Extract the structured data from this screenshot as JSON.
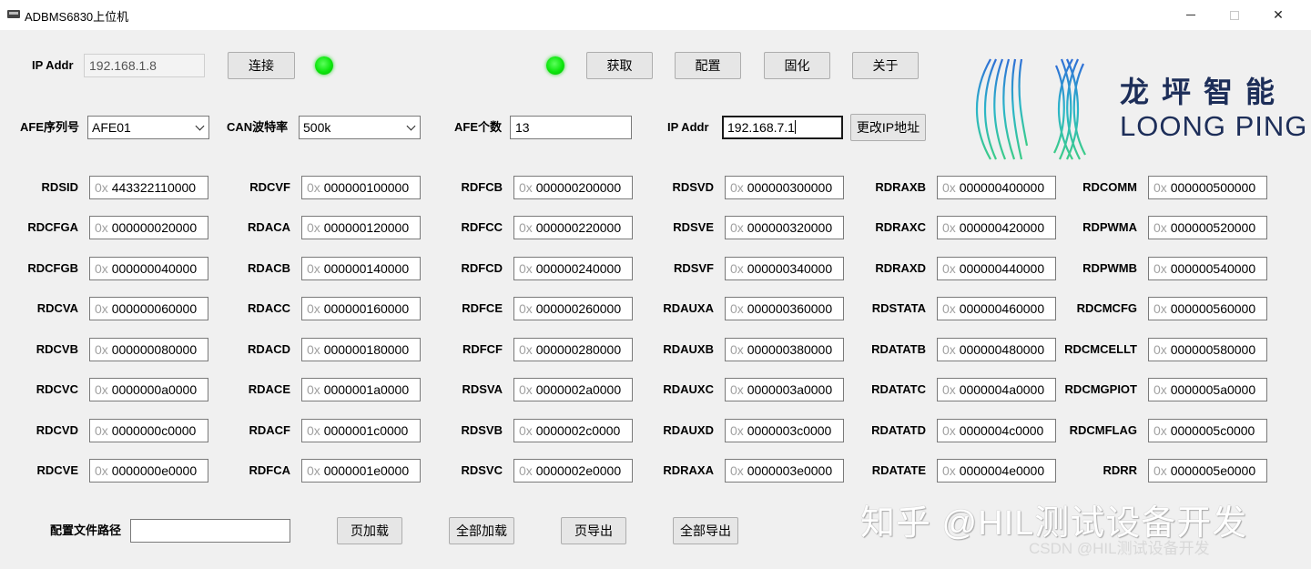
{
  "window": {
    "title": "ADBMS6830上位机",
    "min_icon": "minimize-icon",
    "max_icon": "maximize-icon",
    "close_label": "✕"
  },
  "connection": {
    "ip_label": "IP Addr",
    "ip_value": "192.168.1.8",
    "connect_button": "连接",
    "status_led_color": "#19e619"
  },
  "actions": {
    "get_button": "获取",
    "config_button": "配置",
    "burn_button": "固化",
    "about_button": "关于",
    "status_led_color": "#19e619"
  },
  "settings": {
    "afe_serial_label": "AFE序列号",
    "afe_serial_value": "AFE01",
    "can_rate_label": "CAN波特率",
    "can_rate_value": "500k",
    "afe_count_label": "AFE个数",
    "afe_count_value": "13",
    "new_ip_label": "IP Addr",
    "new_ip_value": "192.168.7.1",
    "change_ip_button": "更改IP地址"
  },
  "brand": {
    "name_cn": "龙坪智能",
    "name_en": "LOONG PING",
    "logo_color": "#1d2e59"
  },
  "hex_prefix": "0x",
  "registers": [
    [
      {
        "name": "RDSID",
        "value": "443322110000"
      },
      {
        "name": "RDCFGA",
        "value": "000000020000"
      },
      {
        "name": "RDCFGB",
        "value": "000000040000"
      },
      {
        "name": "RDCVA",
        "value": "000000060000"
      },
      {
        "name": "RDCVB",
        "value": "000000080000"
      },
      {
        "name": "RDCVC",
        "value": "0000000a0000"
      },
      {
        "name": "RDCVD",
        "value": "0000000c0000"
      },
      {
        "name": "RDCVE",
        "value": "0000000e0000"
      }
    ],
    [
      {
        "name": "RDCVF",
        "value": "000000100000"
      },
      {
        "name": "RDACA",
        "value": "000000120000"
      },
      {
        "name": "RDACB",
        "value": "000000140000"
      },
      {
        "name": "RDACC",
        "value": "000000160000"
      },
      {
        "name": "RDACD",
        "value": "000000180000"
      },
      {
        "name": "RDACE",
        "value": "0000001a0000"
      },
      {
        "name": "RDACF",
        "value": "0000001c0000"
      },
      {
        "name": "RDFCA",
        "value": "0000001e0000"
      }
    ],
    [
      {
        "name": "RDFCB",
        "value": "000000200000"
      },
      {
        "name": "RDFCC",
        "value": "000000220000"
      },
      {
        "name": "RDFCD",
        "value": "000000240000"
      },
      {
        "name": "RDFCE",
        "value": "000000260000"
      },
      {
        "name": "RDFCF",
        "value": "000000280000"
      },
      {
        "name": "RDSVA",
        "value": "0000002a0000"
      },
      {
        "name": "RDSVB",
        "value": "0000002c0000"
      },
      {
        "name": "RDSVC",
        "value": "0000002e0000"
      }
    ],
    [
      {
        "name": "RDSVD",
        "value": "000000300000"
      },
      {
        "name": "RDSVE",
        "value": "000000320000"
      },
      {
        "name": "RDSVF",
        "value": "000000340000"
      },
      {
        "name": "RDAUXA",
        "value": "000000360000"
      },
      {
        "name": "RDAUXB",
        "value": "000000380000"
      },
      {
        "name": "RDAUXC",
        "value": "0000003a0000"
      },
      {
        "name": "RDAUXD",
        "value": "0000003c0000"
      },
      {
        "name": "RDRAXA",
        "value": "0000003e0000"
      }
    ],
    [
      {
        "name": "RDRAXB",
        "value": "000000400000"
      },
      {
        "name": "RDRAXC",
        "value": "000000420000"
      },
      {
        "name": "RDRAXD",
        "value": "000000440000"
      },
      {
        "name": "RDSTATA",
        "value": "000000460000"
      },
      {
        "name": "RDATATB",
        "value": "000000480000"
      },
      {
        "name": "RDATATC",
        "value": "0000004a0000"
      },
      {
        "name": "RDATATD",
        "value": "0000004c0000"
      },
      {
        "name": "RDATATE",
        "value": "0000004e0000"
      }
    ],
    [
      {
        "name": "RDCOMM",
        "value": "000000500000"
      },
      {
        "name": "RDPWMA",
        "value": "000000520000"
      },
      {
        "name": "RDPWMB",
        "value": "000000540000"
      },
      {
        "name": "RDCMCFG",
        "value": "000000560000"
      },
      {
        "name": "RDCMCELLT",
        "value": "000000580000"
      },
      {
        "name": "RDCMGPIOT",
        "value": "0000005a0000"
      },
      {
        "name": "RDCMFLAG",
        "value": "0000005c0000"
      },
      {
        "name": "RDRR",
        "value": "0000005e0000"
      }
    ]
  ],
  "footer": {
    "config_path_label": "配置文件路径",
    "config_path_value": "",
    "page_load_button": "页加载",
    "load_all_button": "全部加载",
    "page_export_button": "页导出",
    "export_all_button": "全部导出"
  },
  "watermark": {
    "main": "知乎 @HIL测试设备开发",
    "sub": "CSDN @HIL测试设备开发"
  }
}
